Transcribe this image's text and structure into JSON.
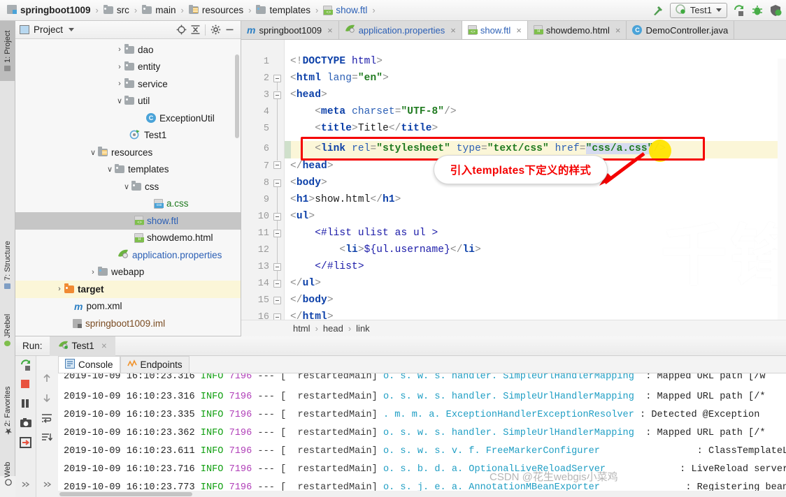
{
  "breadcrumb": {
    "items": [
      {
        "label": "springboot1009",
        "icon": "module-icon",
        "style": "bold"
      },
      {
        "label": "src",
        "icon": "folder-icon",
        "style": "plain"
      },
      {
        "label": "main",
        "icon": "folder-icon",
        "style": "plain"
      },
      {
        "label": "resources",
        "icon": "resources-folder-icon",
        "style": "plain"
      },
      {
        "label": "templates",
        "icon": "folder-icon",
        "style": "plain"
      },
      {
        "label": "show.ftl",
        "icon": "ftl-file-icon",
        "style": "link"
      }
    ],
    "separator": "›"
  },
  "toolbar": {
    "build_icon": "hammer-icon",
    "run_config_name": "Test1",
    "run_config_icon": "spring-run-icon",
    "dropdown_icon": "chevron-down-icon",
    "run_icon": "run-icon",
    "debug_icon": "debug-bug-icon",
    "coverage_icon": "run-coverage-icon"
  },
  "left_strip": {
    "tabs": [
      {
        "label": "1: Project",
        "active": true
      },
      {
        "label": "7: Structure",
        "active": false
      },
      {
        "label": "JRebel",
        "active": false
      },
      {
        "label": "2: Favorites",
        "active": false
      },
      {
        "label": "Web",
        "active": false
      }
    ]
  },
  "project_panel": {
    "title": "Project",
    "dropdown_icon": "chevron-down-icon",
    "locate_icon": "target-icon",
    "collapse_icon": "collapse-all-icon",
    "settings_icon": "gear-icon",
    "hide_icon": "minimize-icon",
    "tree": [
      {
        "label": "dao",
        "indent": 5,
        "arrow": "›",
        "icon": "folder-icon",
        "state": "normal"
      },
      {
        "label": "entity",
        "indent": 5,
        "arrow": "›",
        "icon": "folder-icon",
        "state": "normal"
      },
      {
        "label": "service",
        "indent": 5,
        "arrow": "›",
        "icon": "folder-icon",
        "state": "normal"
      },
      {
        "label": "util",
        "indent": 5,
        "arrow": "∨",
        "icon": "folder-icon",
        "state": "normal"
      },
      {
        "label": "ExceptionUtil",
        "indent": 7,
        "arrow": "",
        "icon": "class-icon",
        "state": "normal"
      },
      {
        "label": "Test1",
        "indent": 6,
        "arrow": "",
        "icon": "spring-class-icon",
        "state": "normal"
      },
      {
        "label": "resources",
        "indent": 4,
        "arrow": "∨",
        "icon": "resources-folder-icon",
        "state": "normal"
      },
      {
        "label": "templates",
        "indent": 5,
        "arrow": "∨",
        "icon": "folder-icon",
        "state": "normal"
      },
      {
        "label": "css",
        "indent": 6,
        "arrow": "∨",
        "icon": "folder-icon",
        "state": "normal"
      },
      {
        "label": "a.css",
        "indent": 8,
        "arrow": "",
        "icon": "css-file-icon",
        "state": "normal"
      },
      {
        "label": "show.ftl",
        "indent": 7,
        "arrow": "",
        "icon": "ftl-file-icon",
        "state": "selected"
      },
      {
        "label": "showdemo.html",
        "indent": 7,
        "arrow": "",
        "icon": "html-file-icon",
        "state": "normal"
      },
      {
        "label": "application.properties",
        "indent": 6,
        "arrow": "",
        "icon": "spring-props-icon",
        "state": "normal"
      },
      {
        "label": "webapp",
        "indent": 5,
        "arrow": "›",
        "icon": "folder-blue-icon",
        "state": "normal"
      },
      {
        "label": "target",
        "indent": 3,
        "arrow": "›",
        "icon": "folder-orange-icon",
        "state": "highlight"
      },
      {
        "label": "pom.xml",
        "indent": 4,
        "arrow": "",
        "icon": "maven-icon",
        "state": "normal"
      },
      {
        "label": "springboot1009.iml",
        "indent": 4,
        "arrow": "",
        "icon": "iml-icon",
        "state": "normal"
      }
    ]
  },
  "editor": {
    "tabs": [
      {
        "label": "springboot1009",
        "icon": "maven-icon",
        "active": false,
        "closable": true
      },
      {
        "label": "application.properties",
        "icon": "spring-props-icon",
        "active": false,
        "closable": true
      },
      {
        "label": "show.ftl",
        "icon": "ftl-file-icon",
        "active": true,
        "closable": true
      },
      {
        "label": "showdemo.html",
        "icon": "html-file-icon",
        "active": false,
        "closable": true
      },
      {
        "label": "DemoController.java",
        "icon": "class-icon",
        "active": false,
        "closable": false
      }
    ],
    "line_numbers": [
      "1",
      "2",
      "3",
      "4",
      "5",
      "6",
      "7",
      "8",
      "9",
      "10",
      "11",
      "12",
      "13",
      "14",
      "15",
      "16"
    ],
    "lines": [
      "<!DOCTYPE html>",
      "<html lang=\"en\">",
      "<head>",
      "    <meta charset=\"UTF-8\"/>",
      "    <title>Title</title>",
      "    <link rel=\"stylesheet\" type=\"text/css\" href=\"css/a.css\"/>",
      "</head>",
      "<body>",
      "<h1>show.html</h1>",
      "<ul>",
      "    <#list ulist as ul >",
      "        <li>${ul.username}</li>",
      "    </#list>",
      "</ul>",
      "</body>",
      "</html>"
    ],
    "highlighted_line": "6",
    "watermark": "千锋教育",
    "structure_breadcrumb": [
      "html",
      "head",
      "link"
    ],
    "breadcrumb_separator": "›"
  },
  "annotation": {
    "text": "引入templates下定义的样式",
    "color": "#f40000",
    "box_color": "#f40000",
    "highlight_color": "#ffe400"
  },
  "run_panel": {
    "label": "Run:",
    "tab_name": "Test1",
    "tab_icon": "spring-run-icon",
    "close_icon": "close-icon",
    "side_buttons": [
      {
        "name": "rerun-icon"
      },
      {
        "name": "stop-icon"
      },
      {
        "name": "pause-icon"
      },
      {
        "name": "screenshot-icon"
      },
      {
        "name": "export-icon"
      },
      {
        "name": "more-icon"
      }
    ],
    "side_buttons2": [
      {
        "name": "scroll-up-icon"
      },
      {
        "name": "scroll-down-icon"
      },
      {
        "name": "soft-wrap-icon"
      },
      {
        "name": "scroll-to-end-icon"
      },
      {
        "name": "more-icon"
      }
    ],
    "console_tabs": [
      {
        "label": "Console",
        "icon": "console-icon",
        "active": true
      },
      {
        "label": "Endpoints",
        "icon": "endpoints-icon",
        "active": false
      }
    ],
    "log_lines": [
      {
        "time": "2019-10-09 16:10:23.316",
        "level": "INFO",
        "pid": "7196",
        "dash": "---",
        "thread": "[  restartedMain]",
        "class": "o. s. w. s. handler. SimpleUrlHandlerMapping",
        "msg": ": Mapped URL path [/w"
      },
      {
        "time": "2019-10-09 16:10:23.316",
        "level": "INFO",
        "pid": "7196",
        "dash": "---",
        "thread": "[  restartedMain]",
        "class": "o. s. w. s. handler. SimpleUrlHandlerMapping",
        "msg": ": Mapped URL path [/*"
      },
      {
        "time": "2019-10-09 16:10:23.335",
        "level": "INFO",
        "pid": "7196",
        "dash": "---",
        "thread": "[  restartedMain]",
        "class": ". m. m. a. ExceptionHandlerExceptionResolver",
        "msg": ": Detected @Exception"
      },
      {
        "time": "2019-10-09 16:10:23.362",
        "level": "INFO",
        "pid": "7196",
        "dash": "---",
        "thread": "[  restartedMain]",
        "class": "o. s. w. s. handler. SimpleUrlHandlerMapping",
        "msg": ": Mapped URL path [/*"
      },
      {
        "time": "2019-10-09 16:10:23.611",
        "level": "INFO",
        "pid": "7196",
        "dash": "---",
        "thread": "[  restartedMain]",
        "class": "o. s. w. s. v. f. FreeMarkerConfigurer",
        "msg": ": ClassTemplateLoader"
      },
      {
        "time": "2019-10-09 16:10:23.716",
        "level": "INFO",
        "pid": "7196",
        "dash": "---",
        "thread": "[  restartedMain]",
        "class": "o. s. b. d. a. OptionalLiveReloadServer",
        "msg": ": LiveReload server "
      },
      {
        "time": "2019-10-09 16:10:23.773",
        "level": "INFO",
        "pid": "7196",
        "dash": "---",
        "thread": "[  restartedMain]",
        "class": "o. s. j. e. a. AnnotationMBeanExporter",
        "msg": ": Registering beans "
      }
    ]
  },
  "watermarks": {
    "csdn": "CSDN @花生webgis小菜鸡"
  }
}
